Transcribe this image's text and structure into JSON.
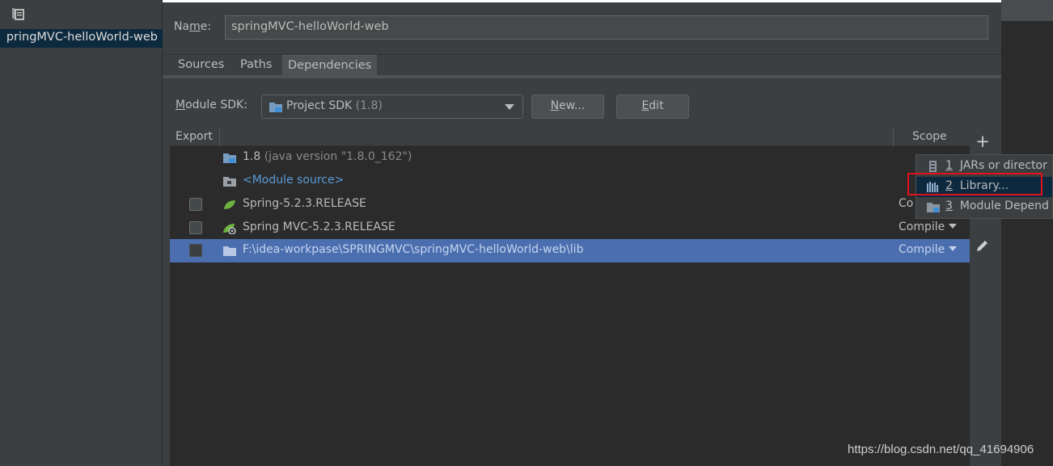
{
  "left_panel": {
    "module_name": "pringMVC-helloWorld-web"
  },
  "name": {
    "label": "Name:",
    "value": "springMVC-helloWorld-web"
  },
  "tabs": [
    {
      "label": "Sources"
    },
    {
      "label": "Paths"
    },
    {
      "label": "Dependencies"
    }
  ],
  "sdk": {
    "label": "Module SDK:",
    "value": "Project SDK",
    "version": "(1.8)",
    "new_label": "New...",
    "edit_label": "Edit"
  },
  "table": {
    "col_export": "Export",
    "col_scope": "Scope",
    "rows": [
      {
        "name": "1.8",
        "detail": "(java version \"1.8.0_162\")",
        "icon": "jdk-folder-icon",
        "scope": ""
      },
      {
        "name": "<Module source>",
        "icon": "module-source-icon",
        "scope": ""
      },
      {
        "name": "Spring-5.2.3.RELEASE",
        "icon": "spring-leaf-icon",
        "scope": "Co"
      },
      {
        "name": "Spring MVC-5.2.3.RELEASE",
        "icon": "spring-mvc-icon",
        "scope": "Compile"
      },
      {
        "name": "F:\\idea-workpase\\SPRINGMVC\\springMVC-helloWorld-web\\lib",
        "icon": "folder-icon",
        "scope": "Compile"
      }
    ]
  },
  "popup": {
    "items": [
      {
        "num": "1",
        "label": "JARs or director"
      },
      {
        "num": "2",
        "label": "Library..."
      },
      {
        "num": "3",
        "label": "Module Depend"
      }
    ]
  },
  "watermark": "https://blog.csdn.net/qq_41694906",
  "colors": {
    "background": "#3c3f41",
    "table_bg": "#2b2b2b",
    "selection": "#4b6eaf",
    "highlight": "#e0101c",
    "module_source": "#5a9bd6"
  }
}
